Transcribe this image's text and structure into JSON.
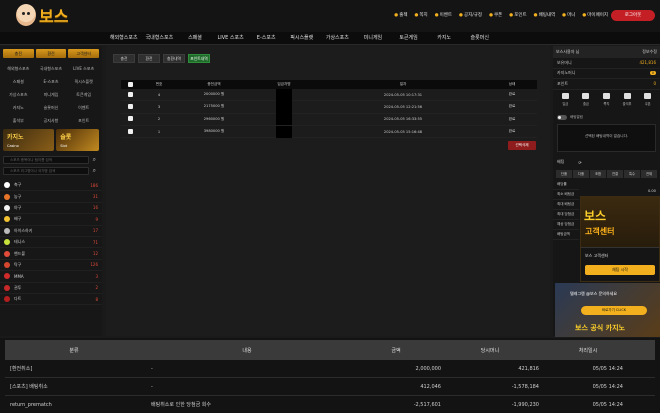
{
  "header": {
    "logo_text": "보스",
    "links": [
      {
        "icon": "●",
        "label": "출첵"
      },
      {
        "icon": "●",
        "label": "쪽지"
      },
      {
        "icon": "●",
        "label": "이벤트"
      },
      {
        "icon": "●",
        "label": "공지/규정"
      },
      {
        "icon": "●",
        "label": "쿠폰"
      },
      {
        "icon": "●",
        "label": "포인트"
      },
      {
        "icon": "●",
        "label": "배팅내역"
      },
      {
        "icon": "●",
        "label": "머니"
      },
      {
        "icon": "●",
        "label": "마이페이지"
      }
    ],
    "logout": "로그아웃"
  },
  "nav": [
    "해외형스포츠",
    "국내형스포츠",
    "스페셜",
    "LIVE 스포츠",
    "E-스포츠",
    "픽시스플랫",
    "가상스포츠",
    "미니게임",
    "토큰게임",
    "카지노",
    "슬롯머신"
  ],
  "left": {
    "top_buttons": [
      "충전",
      "환전",
      "고객센터"
    ],
    "grid": [
      "해외형스포츠",
      "국내형스포츠",
      "LIVE 스포츠",
      "스페셜",
      "E-스포츠",
      "픽시스플랫",
      "가상스포츠",
      "미니게임",
      "토큰게임",
      "카지노",
      "슬롯머신",
      "이벤트",
      "출석부",
      "공지사항",
      "포인트"
    ],
    "banner_casino_title": "카지노",
    "banner_casino_sub": "Casino",
    "banner_slot_title": "슬롯",
    "banner_slot_sub": "Slot",
    "search_placeholder_1": "스포츠 종목이나 팀이름 검색",
    "search_placeholder_2": "스포츠 리그명이나 국가명 검색",
    "sports": [
      {
        "name": "축구",
        "count": "186",
        "color": "#ffffff"
      },
      {
        "name": "농구",
        "count": "31",
        "color": "#e8742a"
      },
      {
        "name": "야구",
        "count": "16",
        "color": "#f4f4f4"
      },
      {
        "name": "배구",
        "count": "9",
        "color": "#f2c233"
      },
      {
        "name": "아이스하키",
        "count": "17",
        "color": "#bbbbbb"
      },
      {
        "name": "테니스",
        "count": "71",
        "color": "#c8e43c"
      },
      {
        "name": "핸드볼",
        "count": "12",
        "color": "#e04b3a"
      },
      {
        "name": "탁구",
        "count": "126",
        "color": "#d4462d"
      },
      {
        "name": "MMA",
        "count": "3",
        "color": "#d02b2b"
      },
      {
        "name": "권투",
        "count": "2",
        "color": "#c72828"
      },
      {
        "name": "다트",
        "count": "8",
        "color": "#b31e1e"
      }
    ]
  },
  "main": {
    "tabs": [
      "충전",
      "환전",
      "충환내역",
      "포인트내역"
    ],
    "active_tab_index": 3,
    "table": {
      "headers": [
        "",
        "번호",
        "충전금액",
        "입금자명",
        "일자",
        "상태"
      ],
      "rows": [
        {
          "no": "4",
          "amount": "2000000 원",
          "date": "2024-05-05 10:17:31",
          "status": "완료"
        },
        {
          "no": "3",
          "amount": "2175000 원",
          "date": "2024-05-05 12:21:56",
          "status": "완료"
        },
        {
          "no": "2",
          "amount": "2960000 원",
          "date": "2024-05-05 16:33:55",
          "status": "완료"
        },
        {
          "no": "1",
          "amount": "3980000 원",
          "date": "2024-05-05 15:16:48",
          "status": "완료"
        }
      ]
    },
    "delete_button": "선택삭제"
  },
  "right": {
    "user_label": "보스사용자 님",
    "user_action": "정보수정",
    "money_label": "보유머니",
    "money_value": "421,816",
    "casino_label": "카지노머니",
    "casino_value": "0",
    "point_label": "포인트",
    "point_value": "0",
    "icons": [
      "입금",
      "출금",
      "쪽지",
      "출석부",
      "쿠폰"
    ],
    "toggle_label": "배팅알림",
    "message": "선택된 배팅내역이 없습니다.",
    "cart_title": "배팅",
    "cart_tabs": [
      "단폴",
      "다폴",
      "조합",
      "연결",
      "특수",
      "전체"
    ],
    "cart_rows": [
      {
        "label": "배당률",
        "value": "0.00"
      },
      {
        "label": "최소 배팅금",
        "value": "0"
      },
      {
        "label": "최대 배팅금",
        "value": "0"
      },
      {
        "label": "최대 당첨금",
        "value": "0"
      },
      {
        "label": "예상 당첨금",
        "value": "0"
      },
      {
        "label": "배팅금액",
        "value": "0"
      }
    ]
  },
  "promo": {
    "title": "보스",
    "subtitle": "고객센터",
    "box_label": "보스 고객센터",
    "box_button": "채팅 시작",
    "promo2_text": "텔레그램 @보스 문의하세요",
    "promo2_button": "바로가기 CLICK",
    "promo2_bottom": "보스 공식 카지노"
  },
  "bottom": {
    "headers": [
      "분류",
      "내용",
      "금액",
      "당시머니",
      "처리일시"
    ],
    "rows": [
      {
        "type": "[환전취소]",
        "content": "-",
        "amount": "2,000,000",
        "balance": "421,816",
        "time": "05/05 14:24"
      },
      {
        "type": "[스포츠] 배팅취소",
        "content": "-",
        "amount": "412,046",
        "balance": "-1,578,184",
        "time": "05/05 14:24"
      },
      {
        "type": "return_prematch",
        "content": "배팅취소로 인한 당첨금 회수",
        "amount": "-2,517,601",
        "balance": "-1,990,230",
        "time": "05/05 14:24"
      }
    ]
  }
}
